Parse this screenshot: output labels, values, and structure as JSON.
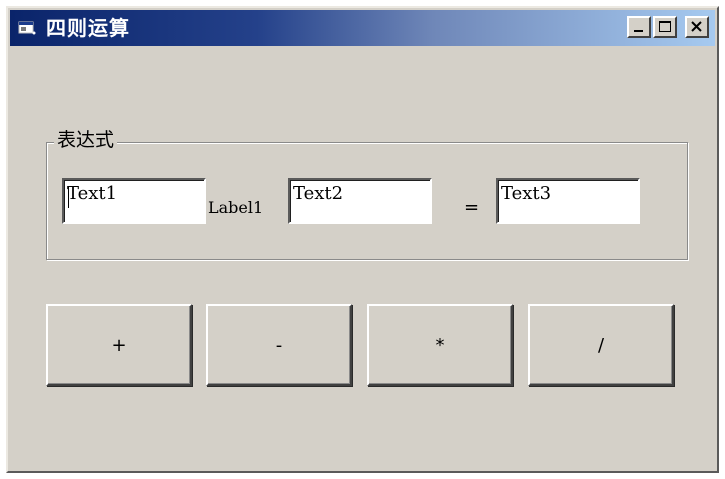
{
  "window": {
    "title": "四则运算",
    "icon": "app-window-icon",
    "controls": {
      "minimize_icon": "minimize-icon",
      "maximize_icon": "maximize-icon",
      "close_icon": "close-icon"
    }
  },
  "expression_group": {
    "label": "表达式",
    "text1": "Text1",
    "operator_label": "Label1",
    "text2": "Text2",
    "equals": "=",
    "text3": "Text3"
  },
  "operators": [
    {
      "label": "+"
    },
    {
      "label": "-"
    },
    {
      "label": "*"
    },
    {
      "label": "/"
    }
  ],
  "colors": {
    "window_background": "#d4d0c8",
    "titlebar_start": "#0a246a",
    "titlebar_end": "#a6caf0"
  }
}
